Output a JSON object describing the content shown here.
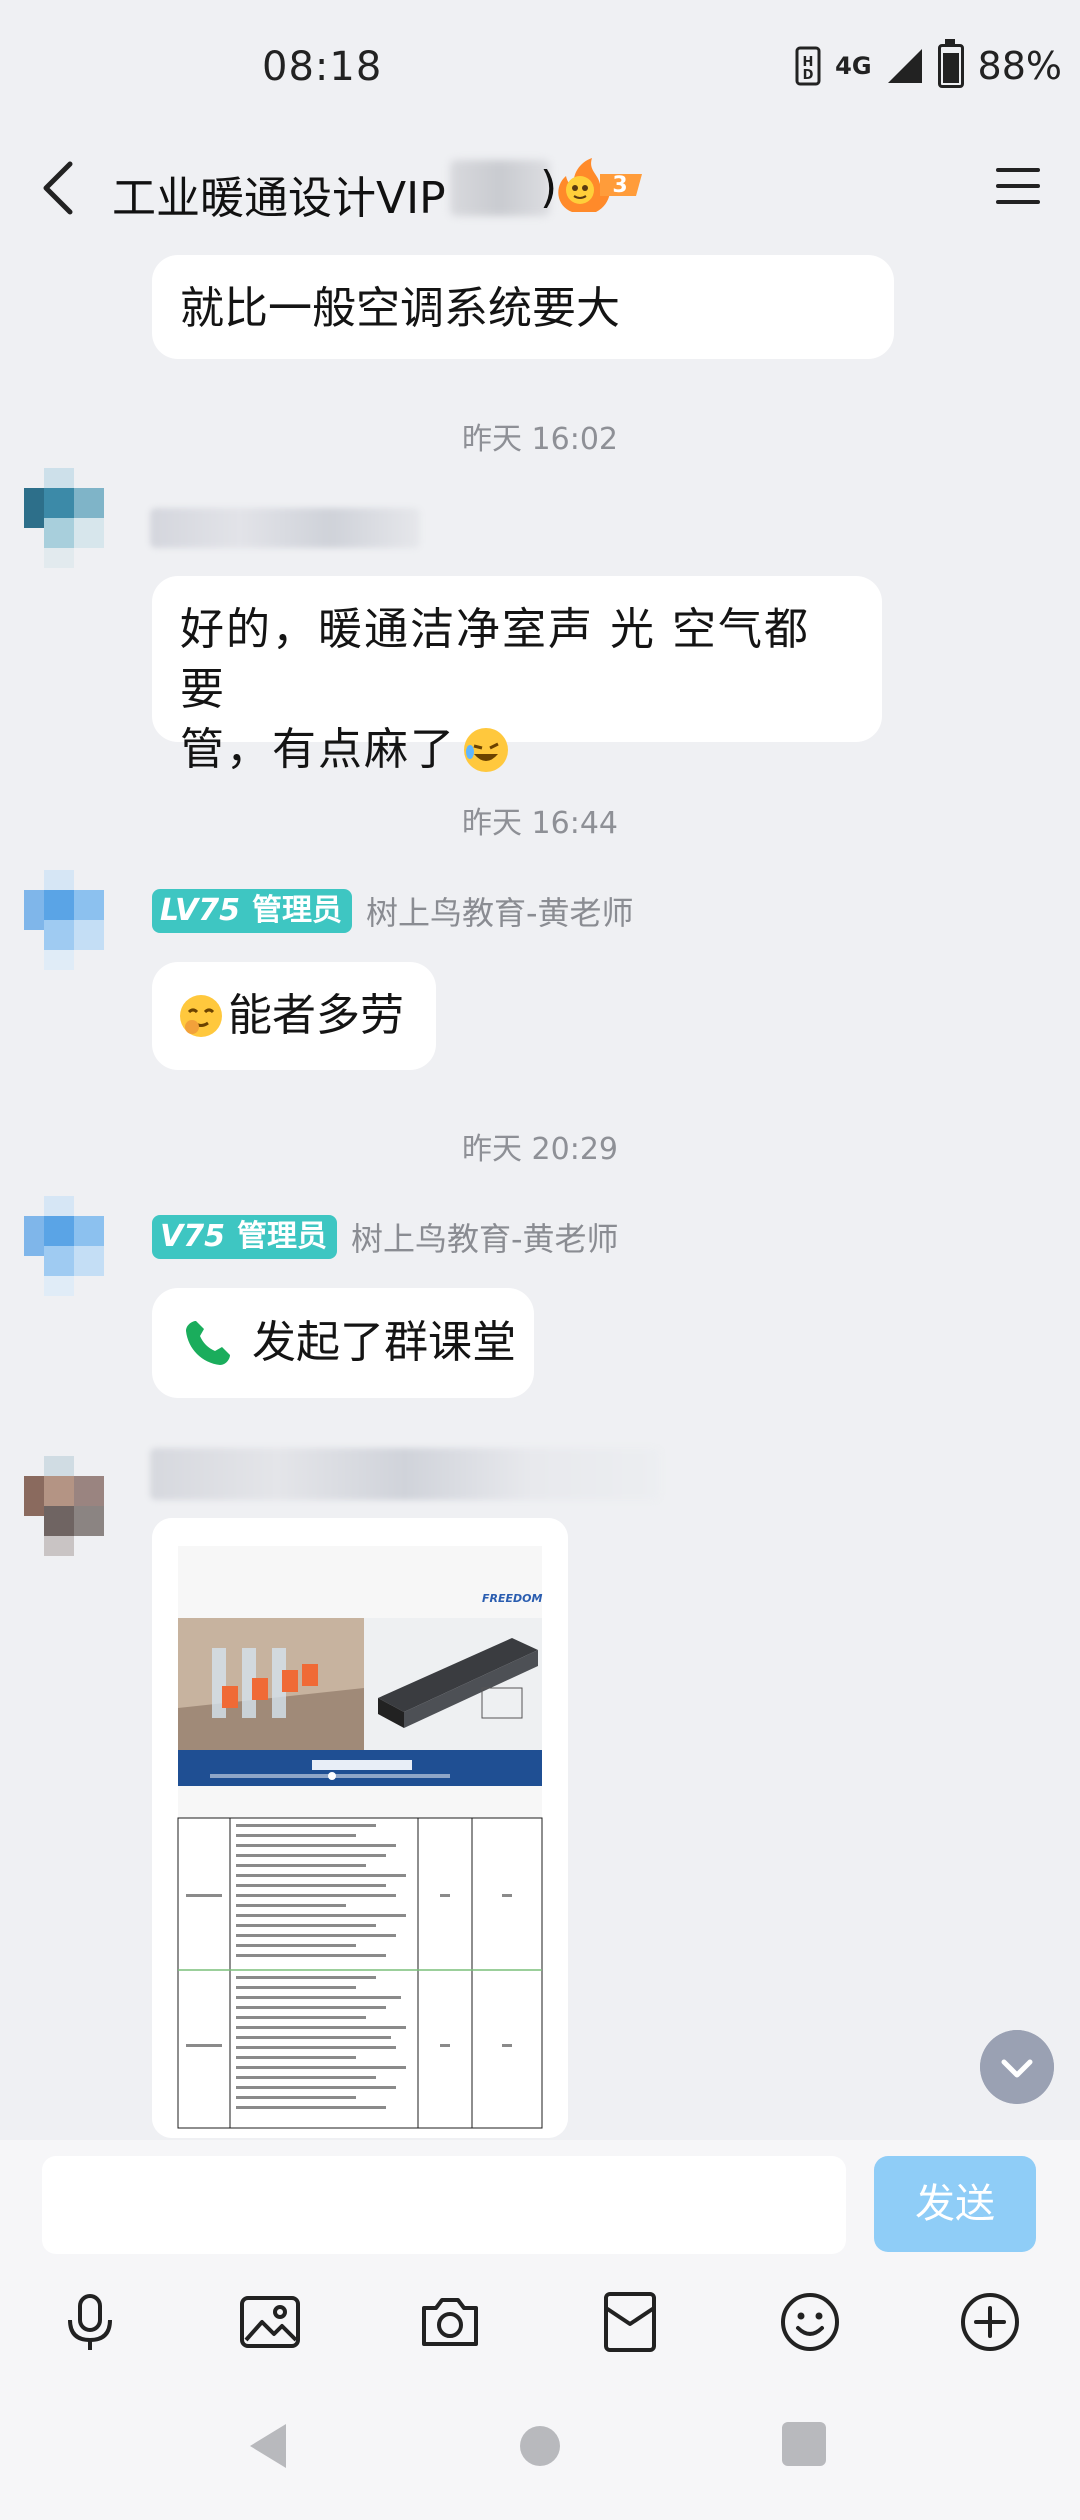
{
  "status_bar": {
    "time": "08:18",
    "network": "4G",
    "battery": "88%"
  },
  "header": {
    "title": "工业暖通设计VIP",
    "title_suffix": ")",
    "fire_count": "3"
  },
  "messages": [
    {
      "type": "text_partial",
      "text_line2": "就比一般空调系统要大"
    },
    {
      "type": "timestamp",
      "text": "昨天 16:02"
    },
    {
      "type": "text",
      "line1": "好的，暖通洁净室声 光 空气都要",
      "line2": "管，有点麻了"
    },
    {
      "type": "timestamp",
      "text": "昨天 16:44"
    },
    {
      "type": "text",
      "role_level": "LV75",
      "role": "管理员",
      "sender": "树上鸟教育-黄老师",
      "text": "能者多劳"
    },
    {
      "type": "timestamp",
      "text": "昨天 20:29"
    },
    {
      "type": "call",
      "role_level": "V75",
      "role": "管理员",
      "sender": "树上鸟教育-黄老师",
      "text": "发起了群课堂"
    },
    {
      "type": "image",
      "caption": "FREEDOM"
    }
  ],
  "composer": {
    "placeholder": "",
    "send_label": "发送"
  },
  "colors": {
    "accent": "#3ec6c2",
    "send": "#8fcdf7",
    "bg": "#eff0f3"
  }
}
